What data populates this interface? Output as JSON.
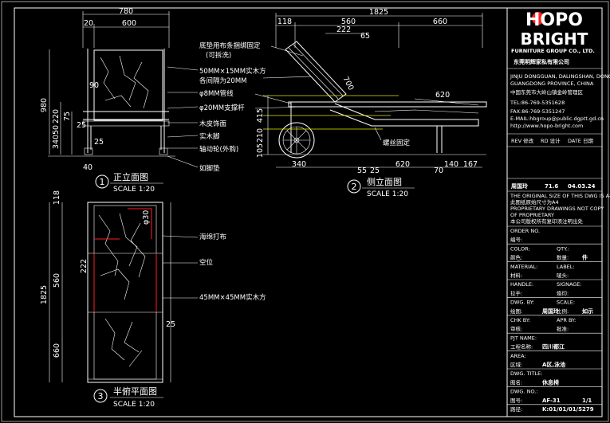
{
  "logo": {
    "top": "HOPO",
    "bottom": "BRIGHT",
    "group": "FURNITURE GROUP CO., LTD.",
    "company_cn": "东莞明辉家私有限公司"
  },
  "company_info": {
    "line1": "JINJU DONGGUAN, DALINGSHAN, DONGGUAN",
    "line2": "GUANGDONG PROVINCE, CHINA",
    "line3": "中国东莞市大岭山镇金岭管理区",
    "tel": "TEL:86-769-5351628",
    "fax": "FAX:86-769-5351247",
    "email": "E-MAIL:hbgroup@public.dgptt.gd.cn",
    "web": "http://www.hopo-bright.com"
  },
  "revision": {
    "headers": [
      "REV 修改",
      "RD 设计",
      "DATE 日期"
    ],
    "row": [
      "周国玲",
      "71.6",
      "04.03.24"
    ]
  },
  "notice": {
    "line1": "THE ORIGINAL SIZE OF THIS DWG IS A4",
    "line2": "此图纸原始尺寸为A4",
    "line3": "PROPRIETARY DRAWINGS NOT COPY",
    "line4": "OF PROPRIETARY",
    "line5": "本公司版权所有复印须注明出处"
  },
  "tb_fields": [
    {
      "label": "ORDER NO.",
      "value": ""
    },
    {
      "label": "编号:",
      "value": ""
    },
    {
      "label": "COLOR:",
      "value": "",
      "label2": "QTY.:",
      "value2": ""
    },
    {
      "label": "颜色:",
      "value": "",
      "label2": "数量:",
      "value2": "件"
    },
    {
      "label": "MATERIAL:",
      "value": "",
      "label2": "LABEL:",
      "value2": ""
    },
    {
      "label": "材料:",
      "value": "",
      "label2": "唛头:",
      "value2": ""
    },
    {
      "label": "HANDLE:",
      "value": "",
      "label2": "SIGNAGE:",
      "value2": ""
    },
    {
      "label": "拉手:",
      "value": "",
      "label2": "烙印:",
      "value2": ""
    },
    {
      "label": "DWG. BY:",
      "value": "",
      "label2": "SCALE:",
      "value2": ""
    },
    {
      "label": "绘图:",
      "value": "周国玲",
      "label2": "比例:",
      "value2": "如示"
    },
    {
      "label": "CHK BY:",
      "value": "",
      "label2": "APR BY:",
      "value2": ""
    },
    {
      "label": "审核:",
      "value": "",
      "label2": "批准:",
      "value2": ""
    },
    {
      "label": "PJT NAME:",
      "value": ""
    },
    {
      "label": "工程名称:",
      "value": "四川都江"
    },
    {
      "label": "AREA:",
      "value": ""
    },
    {
      "label": "区域:",
      "value": "A区,泳池"
    },
    {
      "label": "DWG. TITLE:",
      "value": ""
    },
    {
      "label": "图名:",
      "value": "休息椅"
    },
    {
      "label": "DWG. NO.:",
      "value": ""
    },
    {
      "label": "图号:",
      "value": "AF-31",
      "label2": "",
      "value2": "1/1"
    },
    {
      "label": "路径:",
      "value": "K:01/01/01/5279"
    }
  ],
  "views": {
    "front": {
      "num": "1",
      "title": "正立面图",
      "scale": "SCALE 1:20"
    },
    "side": {
      "num": "2",
      "title": "侧立面图",
      "scale": "SCALE 1:20"
    },
    "plan": {
      "num": "3",
      "title": "半俯平面图",
      "scale": "SCALE 1:20"
    }
  },
  "notes": {
    "n1": "底垫用布条捆绑固定",
    "n1b": "(可拆洗)",
    "n2": "50MM×15MM实木方",
    "n2b": "各间隔为20MM",
    "n3": "φ8MM管线",
    "n4": "φ20MM支撑杆",
    "n5": "木皮饰面",
    "n6": "实木脚",
    "n7": "轴动轮(外购)",
    "n8": "如脚垫",
    "n9": "螺丝固定",
    "n10": "海绵打布",
    "n11": "空位",
    "n12": "45MM×45MM实木方"
  },
  "dims": {
    "front_w_total": "780",
    "front_w_inner": "600",
    "front_w_left": "20",
    "front_h_total": "980",
    "front_h_1": "220",
    "front_h_2": "50",
    "front_h_3": "75",
    "front_h_4": "340",
    "front_d_90": "90",
    "front_d_25": "25",
    "front_d_40": "40",
    "front_d_25b": "25",
    "side_total": "1825",
    "side_118": "118",
    "side_560": "560",
    "side_660": "660",
    "side_222": "222",
    "side_65": "65",
    "side_700": "700",
    "side_620": "620",
    "side_415": "415",
    "side_210": "210",
    "side_105": "105",
    "side_340": "340",
    "side_55": "55",
    "side_25": "25",
    "side_620b": "620",
    "side_70": "70",
    "side_140": "140",
    "side_167": "167",
    "plan_118": "118",
    "plan_30": "φ30",
    "plan_222": "222",
    "plan_560": "560",
    "plan_1825": "1825",
    "plan_660": "660",
    "plan_25": "25"
  },
  "colors": {
    "background": "#000000",
    "line": "#ffffff",
    "accent": "#ff2020",
    "guide": "#e6e600"
  }
}
